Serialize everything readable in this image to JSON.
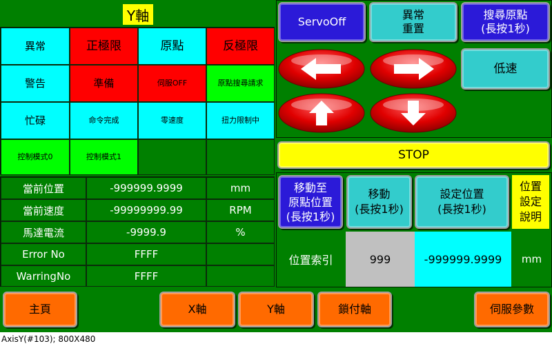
{
  "axis_title": "Y軸",
  "status_grid": {
    "row1": [
      "異常",
      "正極限",
      "原點",
      "反極限"
    ],
    "row2": [
      "警告",
      "準備",
      "伺服OFF",
      "原點搜尋請求"
    ],
    "row3": [
      "忙碌",
      "命令完成",
      "零速度",
      "扭力限制中"
    ],
    "row4": [
      "控制模式0",
      "控制模式1"
    ]
  },
  "monitor": {
    "rows": [
      {
        "label": "當前位置",
        "value": "-999999.9999",
        "unit": "mm"
      },
      {
        "label": "當前速度",
        "value": "-99999999.99",
        "unit": "RPM"
      },
      {
        "label": "馬達電流",
        "value": "-9999.9",
        "unit": "%"
      },
      {
        "label": "Error No",
        "value": "FFFF",
        "unit": ""
      },
      {
        "label": "WarringNo",
        "value": "FFFF",
        "unit": ""
      }
    ]
  },
  "controls": {
    "servo_off": "ServoOff",
    "alarm_reset_1": "異常",
    "alarm_reset_2": "重置",
    "home_search_1": "搜尋原點",
    "home_search_2": "(長按1秒)",
    "low_speed": "低速",
    "stop": "STOP",
    "move_home_1": "移動至",
    "move_home_2": "原點位置",
    "move_home_3": "(長按1秒)",
    "move_1": "移動",
    "move_2": "(長按1秒)",
    "set_pos_1": "設定位置",
    "set_pos_2": "(長按1秒)",
    "pos_help_1": "位置",
    "pos_help_2": "設定",
    "pos_help_3": "說明"
  },
  "position_index": {
    "label": "位置索引",
    "index": "999",
    "value": "-999999.9999",
    "unit": "mm"
  },
  "nav": {
    "home": "主頁",
    "x_axis": "X軸",
    "y_axis": "Y軸",
    "lock_axis": "鎖付軸",
    "servo_params": "伺服參數"
  },
  "statusbar": "AxisY(#103); 800X480",
  "colors": {
    "background": "#008000",
    "cyan": "#00ffff",
    "red": "#ff0000",
    "lime": "#00ff00",
    "blue_button": "#2b1ad8",
    "orange_button": "#ff6a00",
    "stop_button": "#ffff00"
  }
}
